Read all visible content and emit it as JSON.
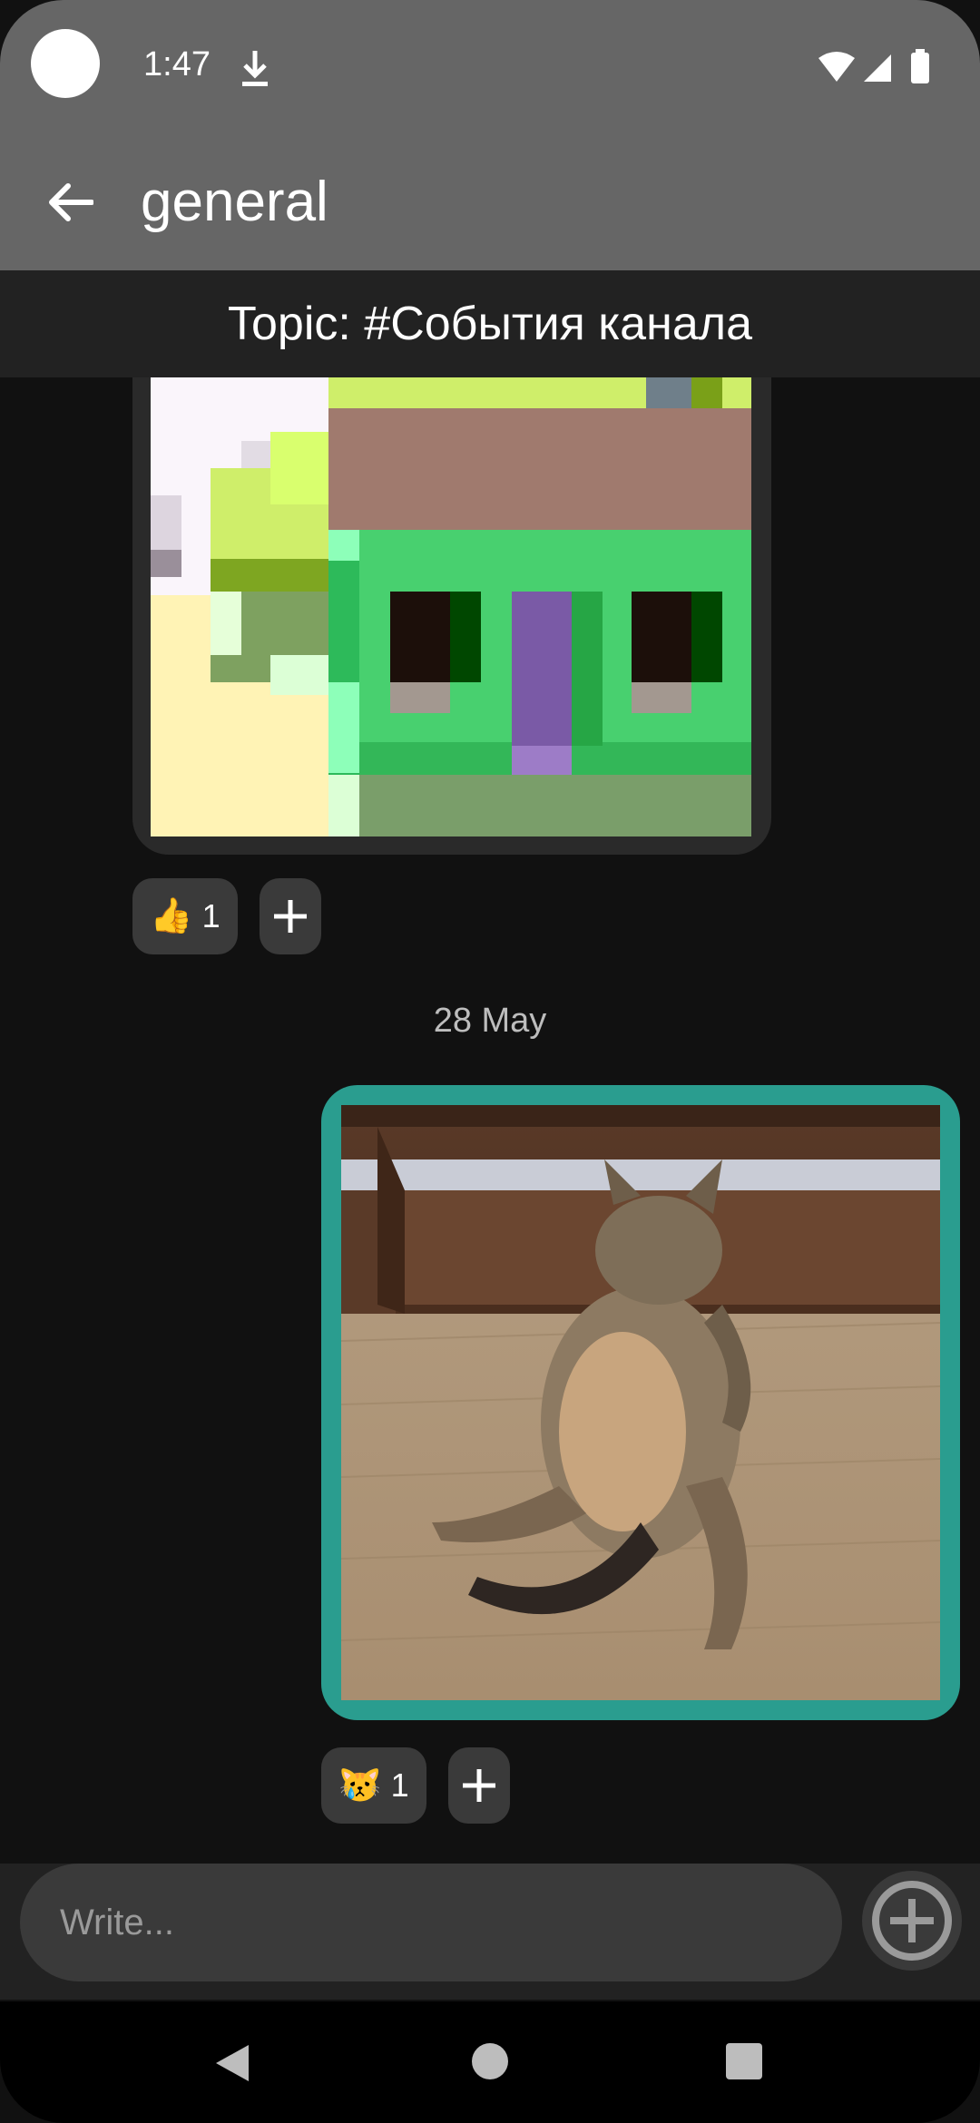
{
  "status_bar": {
    "time": "1:47",
    "icons": [
      "download-icon",
      "wifi-icon",
      "signal-icon",
      "battery-icon"
    ]
  },
  "app_bar": {
    "title": "general",
    "back_icon": "arrow-left-icon"
  },
  "topic": {
    "label": "Topic: #События канала"
  },
  "messages": [
    {
      "type": "image",
      "content": "pixel-art house",
      "reactions": [
        {
          "emoji": "👍",
          "count": "1"
        }
      ]
    },
    {
      "type": "image",
      "content": "cat photo",
      "reactions": [
        {
          "emoji": "😿",
          "count": "1"
        }
      ]
    }
  ],
  "date_separator": "28 May",
  "composer": {
    "placeholder": "Write..."
  },
  "colors": {
    "accent": "#2a9d8f",
    "appbar": "#666666",
    "background": "#111111"
  }
}
